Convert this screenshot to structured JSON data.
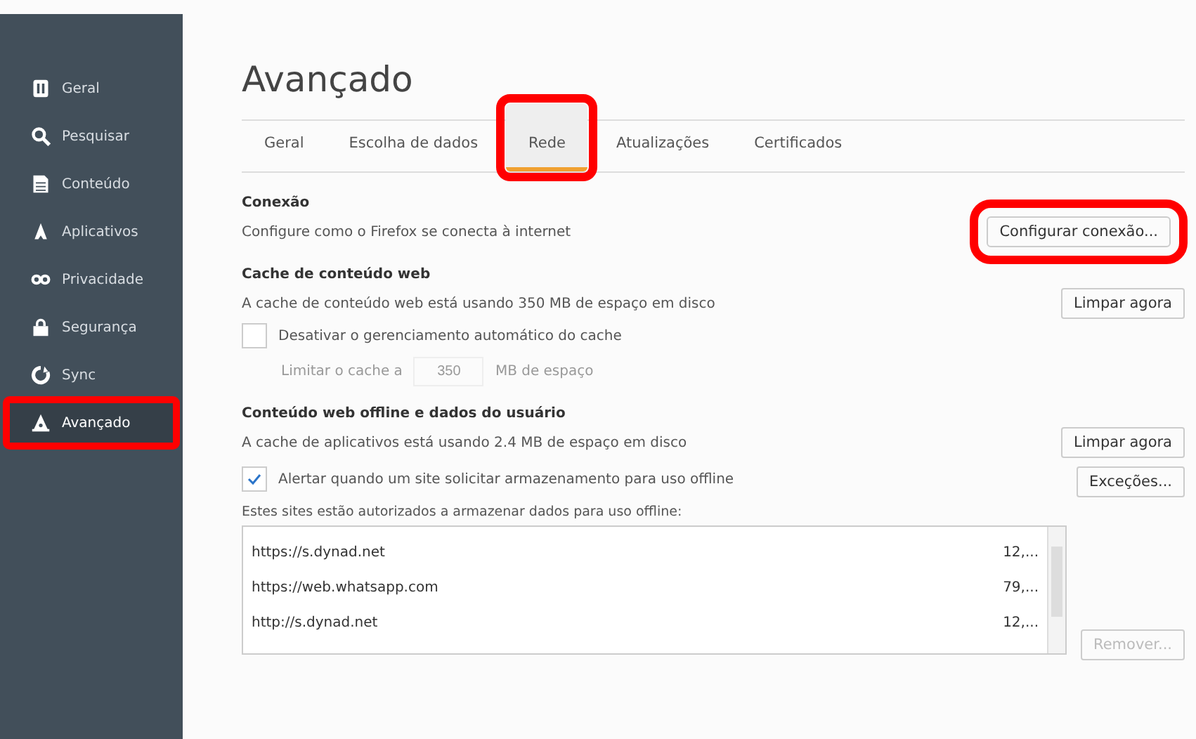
{
  "sidebar": {
    "items": [
      {
        "label": "Geral",
        "selected": false,
        "highlighted": false
      },
      {
        "label": "Pesquisar",
        "selected": false,
        "highlighted": false
      },
      {
        "label": "Conteúdo",
        "selected": false,
        "highlighted": false
      },
      {
        "label": "Aplicativos",
        "selected": false,
        "highlighted": false
      },
      {
        "label": "Privacidade",
        "selected": false,
        "highlighted": false
      },
      {
        "label": "Segurança",
        "selected": false,
        "highlighted": false
      },
      {
        "label": "Sync",
        "selected": false,
        "highlighted": false
      },
      {
        "label": "Avançado",
        "selected": true,
        "highlighted": true
      }
    ]
  },
  "title": "Avançado",
  "tabs": [
    {
      "label": "Geral",
      "selected": false,
      "highlighted": false
    },
    {
      "label": "Escolha de dados",
      "selected": false,
      "highlighted": false
    },
    {
      "label": "Rede",
      "selected": true,
      "highlighted": true
    },
    {
      "label": "Atualizações",
      "selected": false,
      "highlighted": false
    },
    {
      "label": "Certificados",
      "selected": false,
      "highlighted": false
    }
  ],
  "connection": {
    "heading": "Conexão",
    "text": "Configure como o Firefox se conecta à internet",
    "button": {
      "label": "Configurar conexão...",
      "highlighted": true
    }
  },
  "cache": {
    "heading": "Cache de conteúdo web",
    "text": "A cache de conteúdo web está usando 350 MB de espaço em disco",
    "button": "Limpar agora",
    "override": {
      "label": "Desativar o gerenciamento automático do cache",
      "checked": false
    },
    "limit_label": "Limitar o cache a",
    "limit_value": "350",
    "limit_unit": "MB de espaço",
    "limit_disabled": true
  },
  "offline": {
    "heading": "Conteúdo web offline e dados do usuário",
    "text": "A cache de aplicativos está usando 2.4 MB de espaço em disco",
    "button": "Limpar agora",
    "warn": {
      "label": "Alertar quando um site solicitar armazenamento para uso offline",
      "checked": true
    },
    "exceptions_button": "Exceções...",
    "list_label": "Estes sites estão autorizados a armazenar dados para uso offline:",
    "sites": [
      {
        "url": "https://s.dynad.net",
        "size": "12,..."
      },
      {
        "url": "https://web.whatsapp.com",
        "size": "79,..."
      },
      {
        "url": "http://s.dynad.net",
        "size": "12,..."
      }
    ],
    "remove_button": {
      "label": "Remover...",
      "disabled": true
    }
  }
}
